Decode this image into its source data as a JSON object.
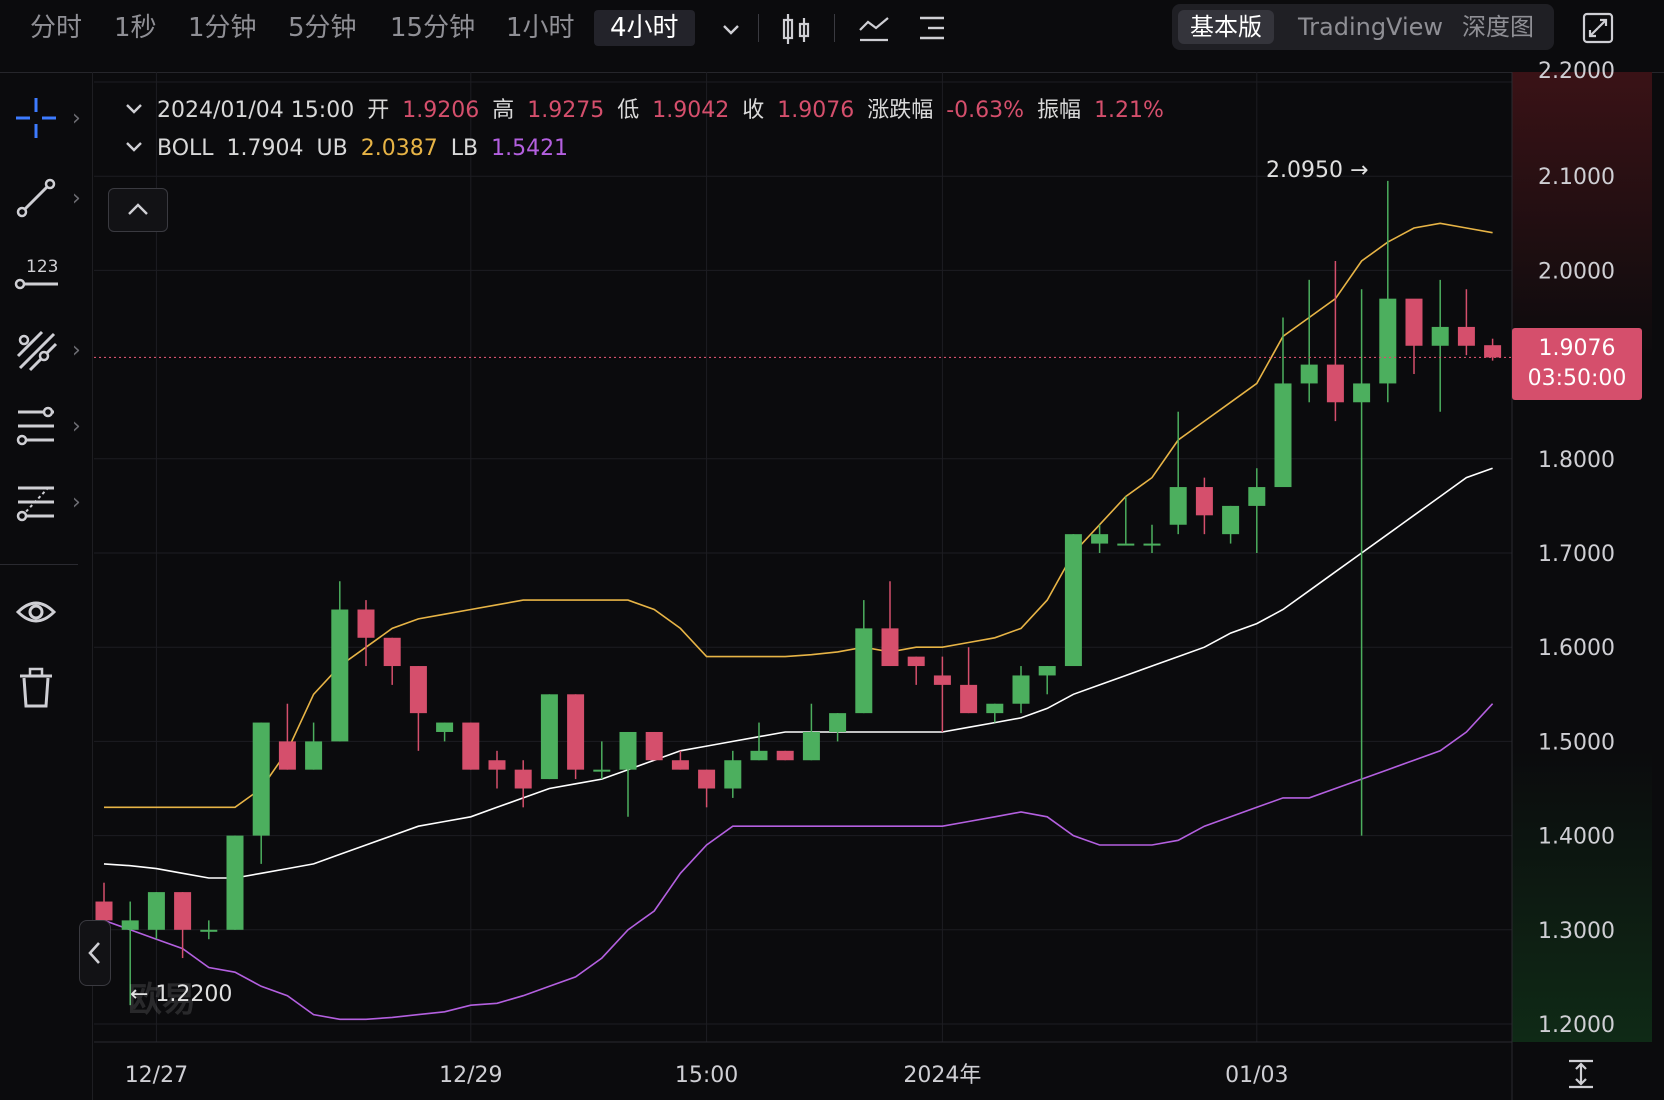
{
  "timeframes": [
    "分时",
    "1秒",
    "1分钟",
    "5分钟",
    "15分钟",
    "1小时",
    "4小时"
  ],
  "active_timeframe": "4小时",
  "view_modes": [
    "基本版",
    "TradingView",
    "深度图"
  ],
  "active_view": "基本版",
  "legend": {
    "datetime": "2024/01/04 15:00",
    "open_label": "开",
    "open": "1.9206",
    "high_label": "高",
    "high": "1.9275",
    "low_label": "低",
    "low": "1.9042",
    "close_label": "收",
    "close": "1.9076",
    "change_label": "涨跌幅",
    "change": "-0.63%",
    "amp_label": "振幅",
    "amp": "1.21%"
  },
  "boll": {
    "label": "BOLL",
    "mid": "1.7904",
    "ub_label": "UB",
    "ub": "2.0387",
    "lb_label": "LB",
    "lb": "1.5421"
  },
  "price_tag": {
    "price": "1.9076",
    "countdown": "03:50:00"
  },
  "annotations": {
    "high_mark": "2.0950 →",
    "low_mark": "← 1.2200"
  },
  "watermark": "欧易",
  "colors": {
    "up": "#4caf5e",
    "down": "#d54f6c",
    "ub": "#e7b446",
    "lb": "#b460e0",
    "mid": "#ffffff"
  },
  "chart_data": {
    "type": "candlestick",
    "y_ticks": [
      "2.2000",
      "2.1000",
      "2.0000",
      "1.8000",
      "1.7000",
      "1.6000",
      "1.5000",
      "1.4000",
      "1.3000",
      "1.2000"
    ],
    "ylim": [
      1.2,
      2.2
    ],
    "x_ticks": [
      "12/27",
      "12/29",
      "15:00",
      "2024年",
      "01/03"
    ],
    "candles": [
      [
        1.33,
        1.35,
        1.3,
        1.31
      ],
      [
        1.3,
        1.33,
        1.22,
        1.31
      ],
      [
        1.3,
        1.34,
        1.29,
        1.34
      ],
      [
        1.34,
        1.34,
        1.27,
        1.3
      ],
      [
        1.3,
        1.31,
        1.29,
        1.3
      ],
      [
        1.3,
        1.4,
        1.3,
        1.4
      ],
      [
        1.4,
        1.52,
        1.37,
        1.52
      ],
      [
        1.5,
        1.54,
        1.47,
        1.47
      ],
      [
        1.47,
        1.52,
        1.47,
        1.5
      ],
      [
        1.5,
        1.67,
        1.5,
        1.64
      ],
      [
        1.64,
        1.65,
        1.58,
        1.61
      ],
      [
        1.61,
        1.61,
        1.56,
        1.58
      ],
      [
        1.58,
        1.58,
        1.49,
        1.53
      ],
      [
        1.51,
        1.52,
        1.5,
        1.52
      ],
      [
        1.52,
        1.52,
        1.47,
        1.47
      ],
      [
        1.48,
        1.49,
        1.45,
        1.47
      ],
      [
        1.47,
        1.48,
        1.43,
        1.45
      ],
      [
        1.46,
        1.55,
        1.46,
        1.55
      ],
      [
        1.55,
        1.55,
        1.46,
        1.47
      ],
      [
        1.47,
        1.5,
        1.46,
        1.47
      ],
      [
        1.47,
        1.51,
        1.42,
        1.51
      ],
      [
        1.51,
        1.51,
        1.48,
        1.48
      ],
      [
        1.48,
        1.49,
        1.47,
        1.47
      ],
      [
        1.47,
        1.47,
        1.43,
        1.45
      ],
      [
        1.45,
        1.49,
        1.44,
        1.48
      ],
      [
        1.48,
        1.52,
        1.48,
        1.49
      ],
      [
        1.49,
        1.49,
        1.48,
        1.48
      ],
      [
        1.48,
        1.54,
        1.48,
        1.51
      ],
      [
        1.51,
        1.53,
        1.5,
        1.53
      ],
      [
        1.53,
        1.65,
        1.53,
        1.62
      ],
      [
        1.62,
        1.67,
        1.58,
        1.58
      ],
      [
        1.59,
        1.59,
        1.56,
        1.58
      ],
      [
        1.57,
        1.59,
        1.51,
        1.56
      ],
      [
        1.56,
        1.6,
        1.53,
        1.53
      ],
      [
        1.53,
        1.54,
        1.52,
        1.54
      ],
      [
        1.54,
        1.58,
        1.53,
        1.57
      ],
      [
        1.57,
        1.58,
        1.55,
        1.58
      ],
      [
        1.58,
        1.72,
        1.58,
        1.72
      ],
      [
        1.71,
        1.73,
        1.7,
        1.72
      ],
      [
        1.71,
        1.76,
        1.71,
        1.71
      ],
      [
        1.71,
        1.73,
        1.7,
        1.71
      ],
      [
        1.73,
        1.85,
        1.72,
        1.77
      ],
      [
        1.77,
        1.78,
        1.72,
        1.74
      ],
      [
        1.72,
        1.75,
        1.71,
        1.75
      ],
      [
        1.75,
        1.79,
        1.7,
        1.77
      ],
      [
        1.77,
        1.95,
        1.77,
        1.88
      ],
      [
        1.88,
        1.99,
        1.86,
        1.9
      ],
      [
        1.9,
        2.01,
        1.84,
        1.86
      ],
      [
        1.86,
        1.98,
        1.4,
        1.88
      ],
      [
        1.88,
        2.095,
        1.86,
        1.97
      ],
      [
        1.97,
        1.96,
        1.89,
        1.92
      ],
      [
        1.92,
        1.99,
        1.85,
        1.94
      ],
      [
        1.94,
        1.98,
        1.91,
        1.92
      ],
      [
        1.9206,
        1.9275,
        1.9042,
        1.9076
      ]
    ],
    "boll_ub": [
      1.43,
      1.43,
      1.43,
      1.43,
      1.43,
      1.43,
      1.45,
      1.49,
      1.55,
      1.58,
      1.6,
      1.62,
      1.63,
      1.635,
      1.64,
      1.645,
      1.65,
      1.65,
      1.65,
      1.65,
      1.65,
      1.64,
      1.62,
      1.59,
      1.59,
      1.59,
      1.59,
      1.592,
      1.595,
      1.6,
      1.595,
      1.6,
      1.6,
      1.605,
      1.61,
      1.62,
      1.65,
      1.7,
      1.73,
      1.76,
      1.78,
      1.82,
      1.84,
      1.86,
      1.88,
      1.93,
      1.95,
      1.97,
      2.01,
      2.03,
      2.045,
      2.05,
      2.045,
      2.04
    ],
    "boll_mid": [
      1.37,
      1.368,
      1.365,
      1.36,
      1.355,
      1.355,
      1.36,
      1.365,
      1.37,
      1.38,
      1.39,
      1.4,
      1.41,
      1.415,
      1.42,
      1.43,
      1.44,
      1.45,
      1.455,
      1.46,
      1.47,
      1.48,
      1.49,
      1.495,
      1.5,
      1.505,
      1.51,
      1.51,
      1.51,
      1.51,
      1.51,
      1.51,
      1.51,
      1.515,
      1.52,
      1.525,
      1.535,
      1.55,
      1.56,
      1.57,
      1.58,
      1.59,
      1.6,
      1.615,
      1.625,
      1.64,
      1.66,
      1.68,
      1.7,
      1.72,
      1.74,
      1.76,
      1.78,
      1.79
    ],
    "boll_lb": [
      1.31,
      1.3,
      1.29,
      1.28,
      1.26,
      1.255,
      1.24,
      1.23,
      1.21,
      1.205,
      1.205,
      1.207,
      1.21,
      1.213,
      1.22,
      1.222,
      1.23,
      1.24,
      1.25,
      1.27,
      1.3,
      1.32,
      1.36,
      1.39,
      1.41,
      1.41,
      1.41,
      1.41,
      1.41,
      1.41,
      1.41,
      1.41,
      1.41,
      1.415,
      1.42,
      1.425,
      1.42,
      1.4,
      1.39,
      1.39,
      1.39,
      1.395,
      1.41,
      1.42,
      1.43,
      1.44,
      1.44,
      1.45,
      1.46,
      1.47,
      1.48,
      1.49,
      1.51,
      1.54
    ]
  }
}
